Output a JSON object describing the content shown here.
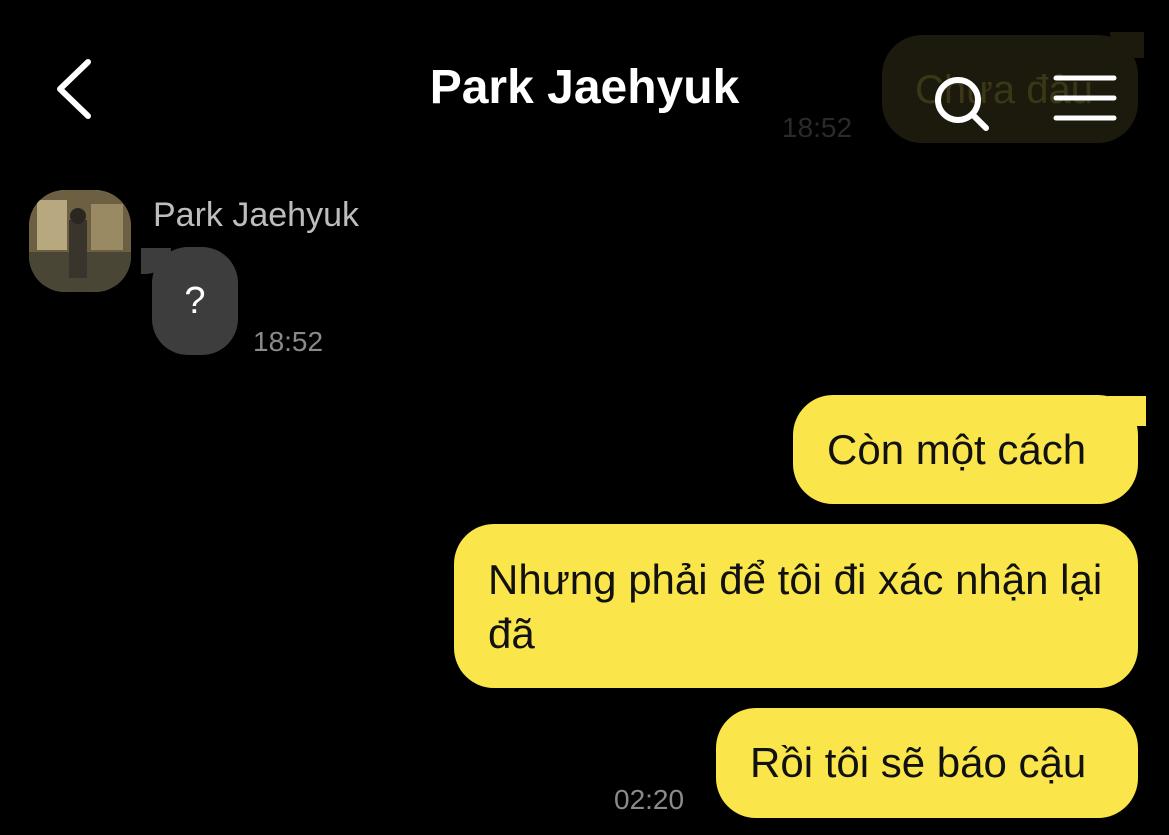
{
  "header": {
    "title": "Park Jaehyuk",
    "back_icon": "chevron-left-icon",
    "search_icon": "search-icon",
    "menu_icon": "menu-icon"
  },
  "ghost_message": {
    "text": "Chưa đâu",
    "time": "18:52"
  },
  "messages": [
    {
      "direction": "incoming",
      "sender": "Park Jaehyuk",
      "text": "?",
      "time": "18:52"
    },
    {
      "direction": "outgoing",
      "text": "Còn một cách"
    },
    {
      "direction": "outgoing",
      "text": "Nhưng phải để tôi đi xác nhận lại đã"
    },
    {
      "direction": "outgoing",
      "text": "Rồi tôi sẽ báo cậu",
      "time": "02:20"
    }
  ],
  "colors": {
    "background": "#000000",
    "outgoing_bubble": "#fae64b",
    "incoming_bubble": "#3d3d3d",
    "timestamp": "#8a8a8a"
  }
}
